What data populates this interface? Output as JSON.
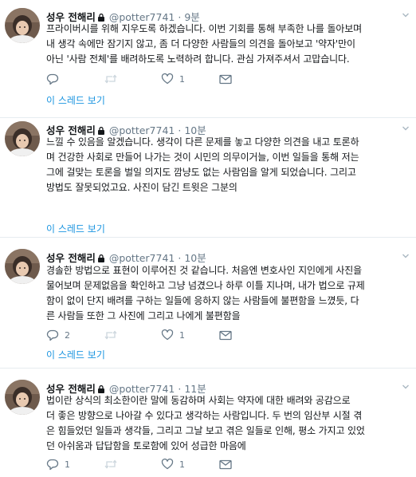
{
  "user": {
    "name": "성우 전해리",
    "handle": "@potter7741",
    "separator": "·"
  },
  "icons": {
    "lock": "lock-icon",
    "reply": "reply-icon",
    "retweet": "retweet-icon",
    "like": "heart-icon",
    "dm": "envelope-icon"
  },
  "colors": {
    "link": "#1b95e0",
    "muted": "#657786",
    "muted_icon": "#ccd6dd"
  },
  "tweets": [
    {
      "time": "9분",
      "text": "프라이버시를 위해 지우도록 하겠습니다. 이번 기회를 통해 부족한 나를 돌아보며\n내 생각 속에만 잠기지 않고, 좀 더 다양한 사람들의 의견을 돌아보고 '약자'만이\n아닌 '사람 전체'를 배려하도록 노력하려 합니다. 관심 가져주셔서 고맙습니다.",
      "replies": "",
      "retweets": "",
      "likes": "1",
      "thread_link": "이 스레드 보기"
    },
    {
      "time": "10분",
      "text": "느낄 수 있음을 알겠습니다. 생각이 다른 문제를 놓고 다양한 의견을 내고 토론하\n며 건강한 사회로 만들어 나가는 것이 시민의 의무이거늘, 이번 일들을 통해 저는\n그에 걸맞는 토론을 벌일 의지도 깜냥도 없는 사람임을 알게 되었습니다. 그리고\n방법도 잘못되었고요. 사진이 담긴 트윗은 그분의",
      "replies": "",
      "retweets": "",
      "likes": "1",
      "thread_link": "이 스레드 보기"
    },
    {
      "time": "10분",
      "text": "경솔한 방법으로 표현이 이루어진 것 같습니다. 처음엔 변호사인 지인에게 사진을\n물어보며 문제없음을 확인하고 그냥 넘겼으나 하루 이틀 지나며, 내가 법으로 규제\n함이 없이 단지 배려를 구하는 일들에 응하지 않는 사람들에 불편함을 느꼈듯, 다\n른 사람들 또한 그 사진에 그리고 나에게 불편함을",
      "replies": "2",
      "retweets": "",
      "likes": "1",
      "thread_link": "이 스레드 보기"
    },
    {
      "time": "11분",
      "text": "법이란 상식의 최소한이란 말에 동감하며 사회는 약자에 대한 배려와 공감으로\n더 좋은 방향으로 나아갈 수 있다고 생각하는 사람입니다. 두 번의 임산부 시절 겪\n은 힘들었던 일들과 생각들, 그리고 그날 보고 겪은 일들로 인해, 평소 가지고 있었\n던 아쉬움과 답답함을 토로함에 있어 성급한 마음에",
      "replies": "1",
      "retweets": "",
      "likes": "1",
      "thread_link": ""
    }
  ]
}
